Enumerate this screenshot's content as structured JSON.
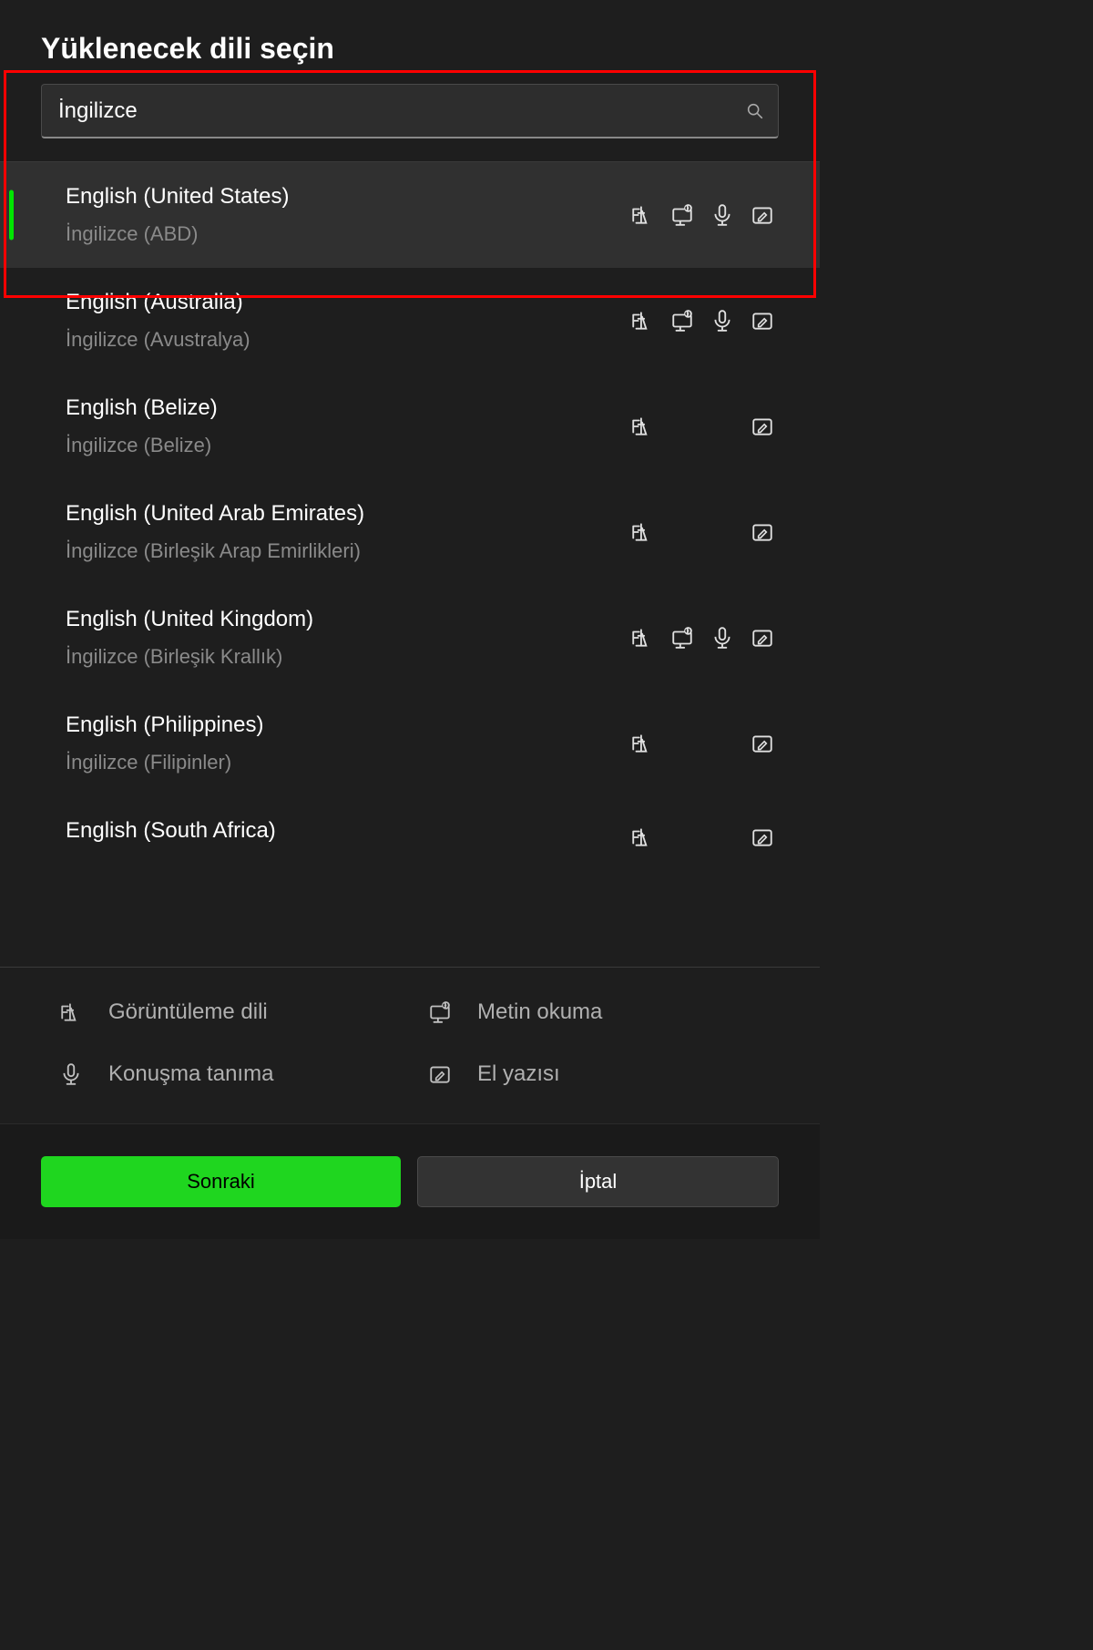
{
  "title": "Yüklenecek dili seçin",
  "search": {
    "value": "İngilizce"
  },
  "languages": [
    {
      "name": "English (United States)",
      "native": "İngilizce (ABD)",
      "display": true,
      "tts": true,
      "speech": true,
      "handwriting": true,
      "selected": true
    },
    {
      "name": "English (Australia)",
      "native": "İngilizce (Avustralya)",
      "display": true,
      "tts": true,
      "speech": true,
      "handwriting": true,
      "selected": false
    },
    {
      "name": "English (Belize)",
      "native": "İngilizce (Belize)",
      "display": true,
      "tts": false,
      "speech": false,
      "handwriting": true,
      "selected": false
    },
    {
      "name": "English (United Arab Emirates)",
      "native": "İngilizce (Birleşik Arap Emirlikleri)",
      "display": true,
      "tts": false,
      "speech": false,
      "handwriting": true,
      "selected": false
    },
    {
      "name": "English (United Kingdom)",
      "native": "İngilizce (Birleşik Krallık)",
      "display": true,
      "tts": true,
      "speech": true,
      "handwriting": true,
      "selected": false
    },
    {
      "name": "English (Philippines)",
      "native": "İngilizce (Filipinler)",
      "display": true,
      "tts": false,
      "speech": false,
      "handwriting": true,
      "selected": false
    },
    {
      "name": "English (South Africa)",
      "native": "",
      "display": true,
      "tts": false,
      "speech": false,
      "handwriting": true,
      "selected": false
    }
  ],
  "legend": {
    "display": "Görüntüleme dili",
    "tts": "Metin okuma",
    "speech": "Konuşma tanıma",
    "handwriting": "El yazısı"
  },
  "buttons": {
    "next": "Sonraki",
    "cancel": "İptal"
  }
}
